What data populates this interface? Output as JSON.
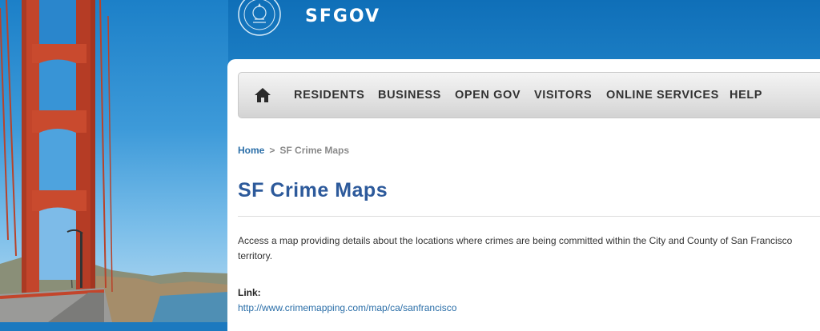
{
  "header": {
    "brand_name": "SFGOV"
  },
  "nav": {
    "home_icon": "home-icon",
    "items": [
      "RESIDENTS",
      "BUSINESS",
      "OPEN GOV",
      "VISITORS",
      "ONLINE SERVICES",
      "HELP"
    ]
  },
  "breadcrumb": {
    "home": "Home",
    "separator": ">",
    "current": "SF Crime Maps"
  },
  "page": {
    "title": "SF Crime Maps",
    "description": "Access a map providing details about the locations where crimes are being committed within the City and County of San Francisco territory.",
    "link_label": "Link:",
    "link_url": "http://www.crimemapping.com/map/ca/sanfrancisco"
  },
  "colors": {
    "title": "#2d5a9b",
    "link": "#2a6ea8",
    "header_blue": "#1b79bf"
  }
}
